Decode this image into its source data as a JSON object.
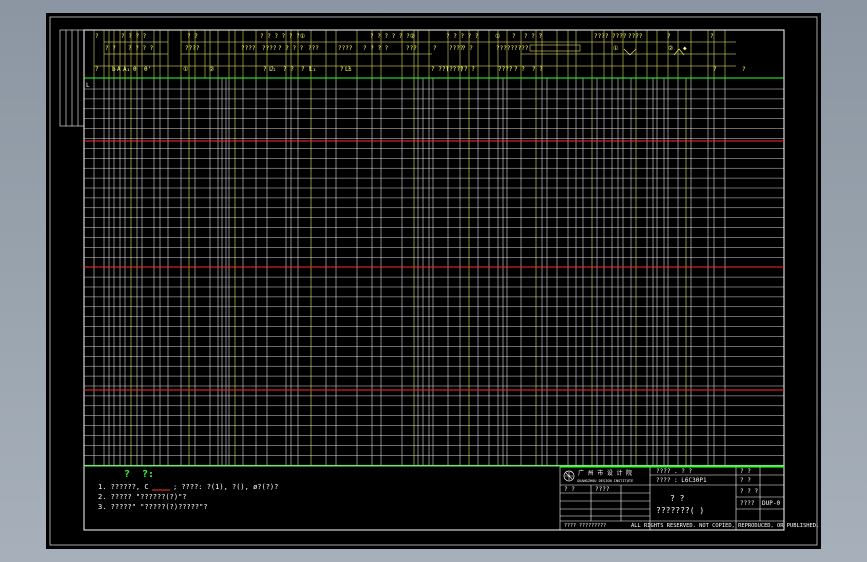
{
  "sheet": {
    "row_marker": "L",
    "header_top": [
      "?",
      "? ? ? ?",
      "? ?",
      "? ? ? ? ? ?①",
      "? ? ? ? ? ?②",
      "? ? ? ? ?",
      "①",
      "?",
      "? ? ?",
      "????",
      "????",
      "????",
      "?",
      "?"
    ],
    "header_mid": [
      "? ?",
      "? ? ? ?",
      "????",
      "????",
      "????",
      "? ? ? ?",
      "???",
      "????",
      "? ? ? ?",
      "???",
      "?",
      "????",
      "? ?",
      "?????????",
      "①",
      "②",
      "◆"
    ],
    "header_bottom": [
      "?",
      "b",
      "A",
      "A₁",
      "θ",
      "θ'",
      "①",
      "②",
      "? ?",
      "L₂",
      "? ?",
      "? ?",
      "L₁",
      "? ?",
      "L₂",
      "? ? ? ? ?",
      "?(? ?)",
      "? ?",
      "????",
      "? ?",
      "? ?",
      "?",
      "?"
    ]
  },
  "notes": {
    "heading_a": "?",
    "heading_b": "?:",
    "line1_prefix": "1. ??????,  C",
    "line1_suffix": ";   ????:   ?(1), ?(), ø?(?)?",
    "line2": "2. ????? \"??????(?)\"?",
    "line3": "3. ?????\" \"?????(?)?????\"?"
  },
  "title_block": {
    "company_cn": "广 州 市 设 计 院",
    "company_en": "GUANGZHOU DESIGN INSTITUTE",
    "field_1": "???? . ?  ?",
    "field_2": "????  :  L6C30P1",
    "field_3": "? ?",
    "field_4": "? ?",
    "drawing_title": "? ?",
    "drawing_subtitle": "???????(     )",
    "cell_a": "? ?",
    "cell_b": "????",
    "cell_c": "? ? ?",
    "cell_d": "????",
    "dwg_code": "DUP-0",
    "footer_left": "???? ?????????",
    "rights": "ALL RIGHTS RESERVED. NOT COPIED, REPRODUCED, OR PUBLISHED."
  },
  "colors": {
    "background": "#8c97a3",
    "sheet": "#000000",
    "grid": "#ffffff",
    "header_lines": "#ffff66",
    "accent_green": "#33ff33",
    "red_lines": "#ff2a2a"
  }
}
